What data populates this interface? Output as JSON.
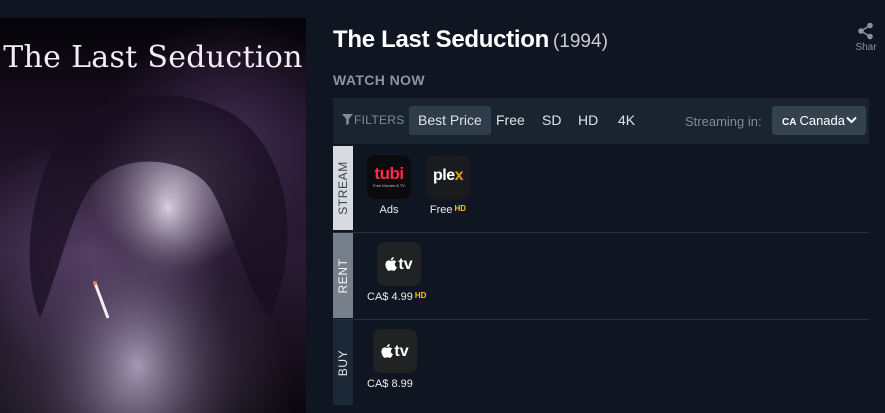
{
  "poster": {
    "title": "The Last Seduction"
  },
  "movie": {
    "title": "The Last Seduction",
    "year": "(1994)"
  },
  "share": {
    "label": "Shar",
    "icon": "share-icon"
  },
  "watch_now": "WATCH NOW",
  "filters": {
    "label": "FILTERS",
    "chips": [
      "Best Price",
      "Free",
      "SD",
      "HD",
      "4K"
    ],
    "active": "Best Price",
    "streaming_in_label": "Streaming in:",
    "country_code": "CA",
    "country": "Canada"
  },
  "offers": {
    "stream": {
      "tab": "STREAM",
      "items": [
        {
          "provider": "tubi",
          "logo_text": "tubi",
          "logo_sub": "Free Movies & TV",
          "label": "Ads",
          "quality": ""
        },
        {
          "provider": "plex",
          "logo_text": "plex",
          "label": "Free",
          "quality": "HD"
        }
      ]
    },
    "rent": {
      "tab": "RENT",
      "items": [
        {
          "provider": "apple-tv",
          "logo_text": "tv",
          "label": "CA$ 4.99",
          "quality": "HD"
        }
      ]
    },
    "buy": {
      "tab": "BUY",
      "items": [
        {
          "provider": "apple-tv",
          "logo_text": "tv",
          "label": "CA$ 8.99",
          "quality": ""
        }
      ]
    }
  },
  "colors": {
    "background": "#0f1622",
    "filter_bar": "#1a2430",
    "tubi_red": "#ff2a4a",
    "plex_orange": "#e5a00d",
    "hd_badge": "#f5c518"
  }
}
